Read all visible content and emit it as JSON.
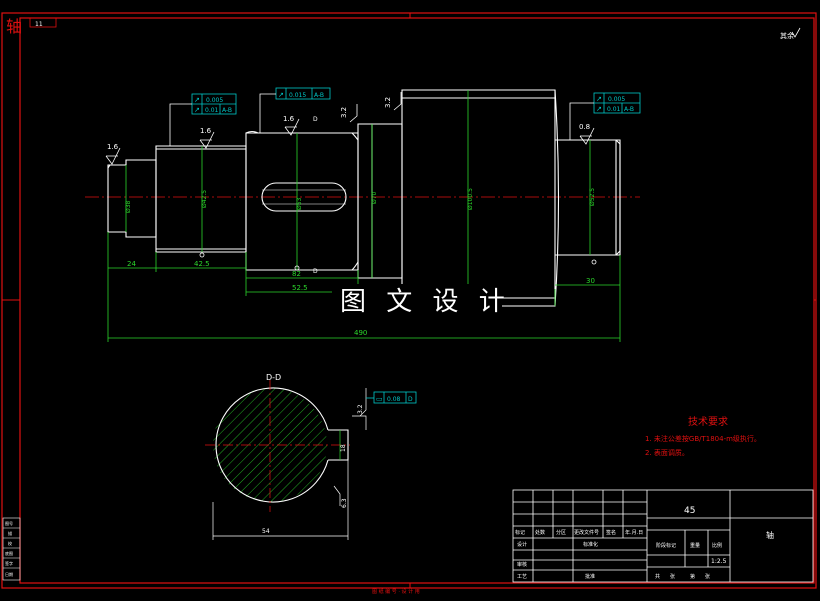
{
  "corner_stamp": {
    "char": "轴",
    "box_label": "11"
  },
  "top_right_note": "其余",
  "watermark": "图 文 设 计",
  "section": {
    "label": "D-D",
    "flatness": "0.08",
    "flatness_datum": "D",
    "rough_top": "3.2",
    "rough_side": "6.3",
    "key_depth": "18",
    "width": "54"
  },
  "roughness": [
    "1.6",
    "1.6",
    "1.6",
    "3.2",
    "3.2",
    "0.8"
  ],
  "tolerance_frames": [
    {
      "rows": [
        [
          "↗",
          "0.005",
          ""
        ],
        [
          "↗",
          "0.01",
          "A-B"
        ]
      ]
    },
    {
      "rows": [
        [
          "↗",
          "0.015",
          "A-B"
        ]
      ]
    },
    {
      "rows": [
        [
          "↗",
          "0.005",
          ""
        ],
        [
          "↗",
          "0.01",
          "A-B"
        ]
      ]
    }
  ],
  "dimensions": {
    "d1": "Ø38",
    "d2": "Ø42.5",
    "d3": "Ø53",
    "d4": "Ø70",
    "d5": "Ø100.5",
    "d6": "Ø52.5",
    "len_24": "24",
    "len_42_5": "42.5",
    "len_82": "82",
    "len_52_5": "52.5",
    "len_30": "30",
    "len_total": "490",
    "section_mark": "D"
  },
  "tech_req": {
    "title": "技术要求",
    "items": [
      "1. 未注公差按GB/T1804-m级执行。",
      "2. 表面调质。"
    ]
  },
  "title_block": {
    "material": "45",
    "name": "轴",
    "scale": "1:2.5",
    "labels": [
      "标记",
      "处数",
      "分区",
      "更改文件号",
      "签名",
      "年.月.日",
      "设计",
      "标准化",
      "审核",
      "工艺",
      "批准",
      "阶段标记",
      "重量",
      "比例",
      "共",
      "张",
      "第",
      "张"
    ]
  },
  "side_strip": [
    "图号",
    "描",
    "校",
    "底图",
    "签字",
    "日期"
  ],
  "bottom_stamp": "图 纸 编 号 · 设 计 用"
}
